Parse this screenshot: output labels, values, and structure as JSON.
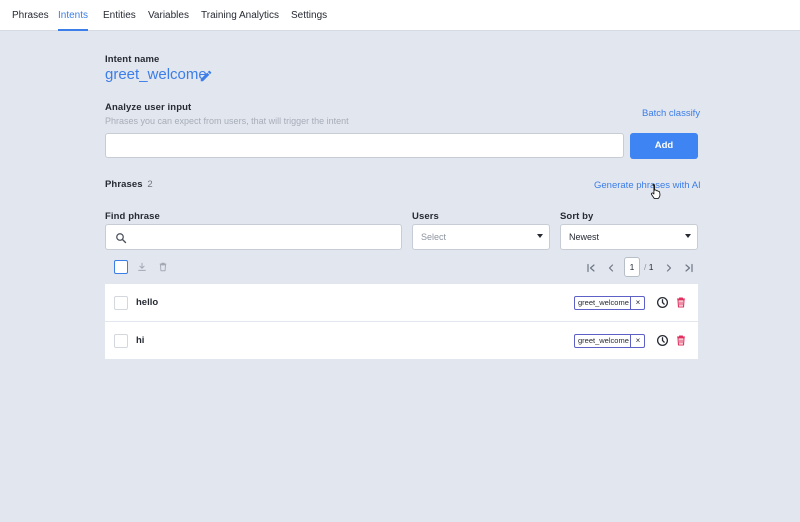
{
  "nav": {
    "tabs": [
      {
        "label": "Phrases"
      },
      {
        "label": "Intents"
      },
      {
        "label": "Entities"
      },
      {
        "label": "Variables"
      },
      {
        "label": "Training Analytics"
      },
      {
        "label": "Settings"
      }
    ],
    "active_tab": "Intents"
  },
  "intent": {
    "name_label": "Intent name",
    "name": "greet_welcome",
    "edit_icon": "pencil-icon"
  },
  "analyze": {
    "label": "Analyze user input",
    "hint": "Phrases you can expect from users, that will trigger the intent",
    "batch_link": "Batch classify",
    "input_value": "",
    "add_button": "Add"
  },
  "phrases": {
    "label": "Phrases",
    "count": "2",
    "generate_link": "Generate phrases with AI"
  },
  "filters": {
    "find_label": "Find phrase",
    "find_value": "",
    "users_label": "Users",
    "users_placeholder": "Select",
    "sort_label": "Sort by",
    "sort_value": "Newest"
  },
  "pagination": {
    "current_page": "1",
    "separator": "/",
    "total_pages": "1"
  },
  "rows": [
    {
      "text": "hello",
      "tag": "greet_welcome",
      "tag_remove": "×"
    },
    {
      "text": "hi",
      "tag": "greet_welcome",
      "tag_remove": "×"
    }
  ],
  "colors": {
    "accent": "#3b7de9",
    "button": "#3f84f3",
    "background": "#e2e6ee",
    "tag_border": "#5d60c6",
    "delete": "#e0315e"
  }
}
